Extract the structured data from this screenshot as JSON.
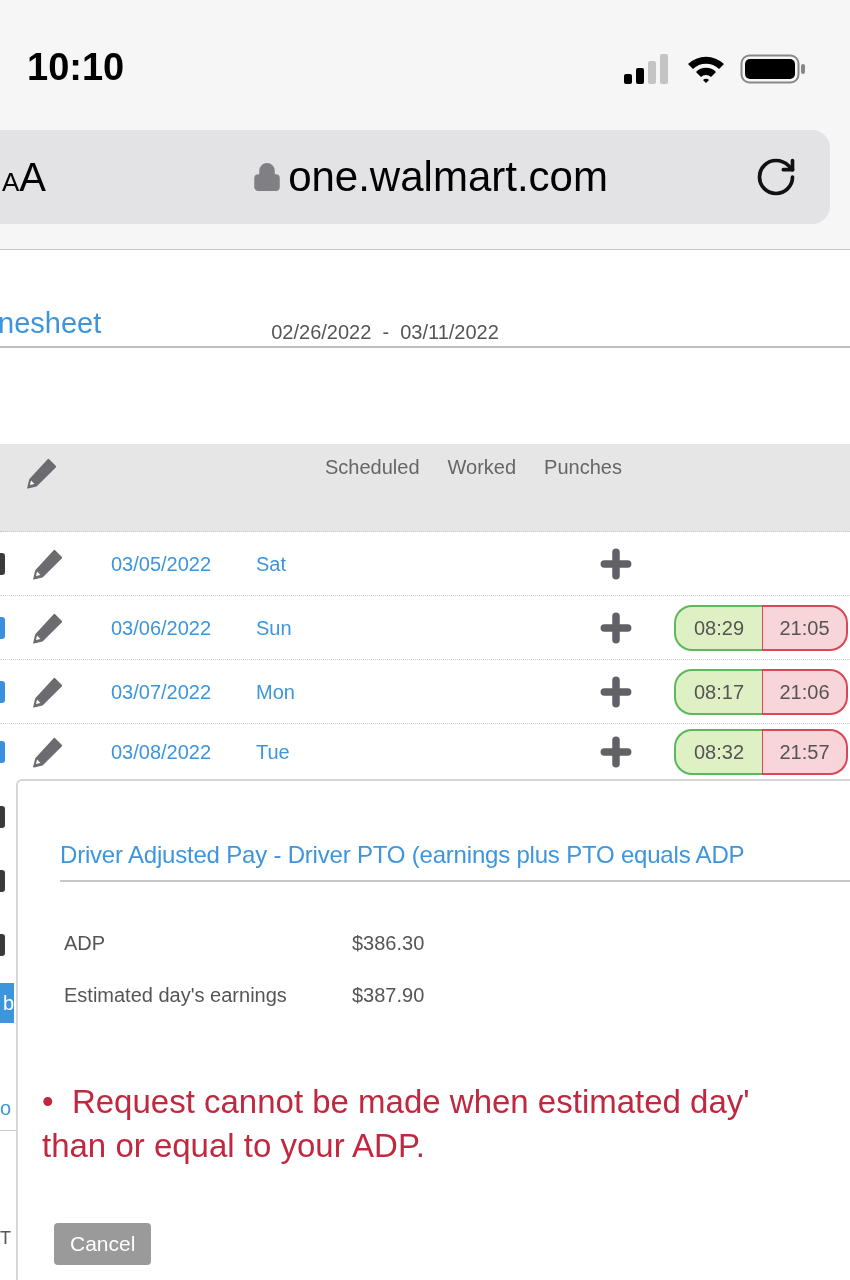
{
  "status_bar": {
    "time": "10:10"
  },
  "address_bar": {
    "text_size_button": "AA",
    "url": "one.walmart.com"
  },
  "page": {
    "title": "nesheet",
    "date_range": "02/26/2022  -  03/11/2022"
  },
  "table": {
    "columns": [
      "Scheduled",
      "Worked",
      "Punches"
    ],
    "rows": [
      {
        "checked": false,
        "date": "03/05/2022",
        "day": "Sat"
      },
      {
        "checked": true,
        "date": "03/06/2022",
        "day": "Sun",
        "punch": {
          "in": "08:29",
          "out": "21:05"
        }
      },
      {
        "checked": true,
        "date": "03/07/2022",
        "day": "Mon",
        "punch": {
          "in": "08:17",
          "out": "21:06"
        }
      },
      {
        "checked": true,
        "date": "03/08/2022",
        "day": "Tue",
        "punch": {
          "in": "08:32",
          "out": "21:57"
        }
      }
    ]
  },
  "left_strip": {
    "checkboxes": [
      {
        "checked": false
      },
      {
        "checked": false
      },
      {
        "checked": false
      }
    ],
    "button": "b",
    "link": "o",
    "footer": "T"
  },
  "dialog": {
    "title": "Driver Adjusted Pay - Driver PTO (earnings plus PTO equals ADP",
    "fields": [
      {
        "label": "ADP",
        "value": "$386.30"
      },
      {
        "label": "Estimated day's earnings",
        "value": "$387.90"
      }
    ],
    "error_lines": [
      "•  Request cannot be made when estimated day'",
      "than or equal to your ADP."
    ],
    "cancel_button": "Cancel"
  }
}
